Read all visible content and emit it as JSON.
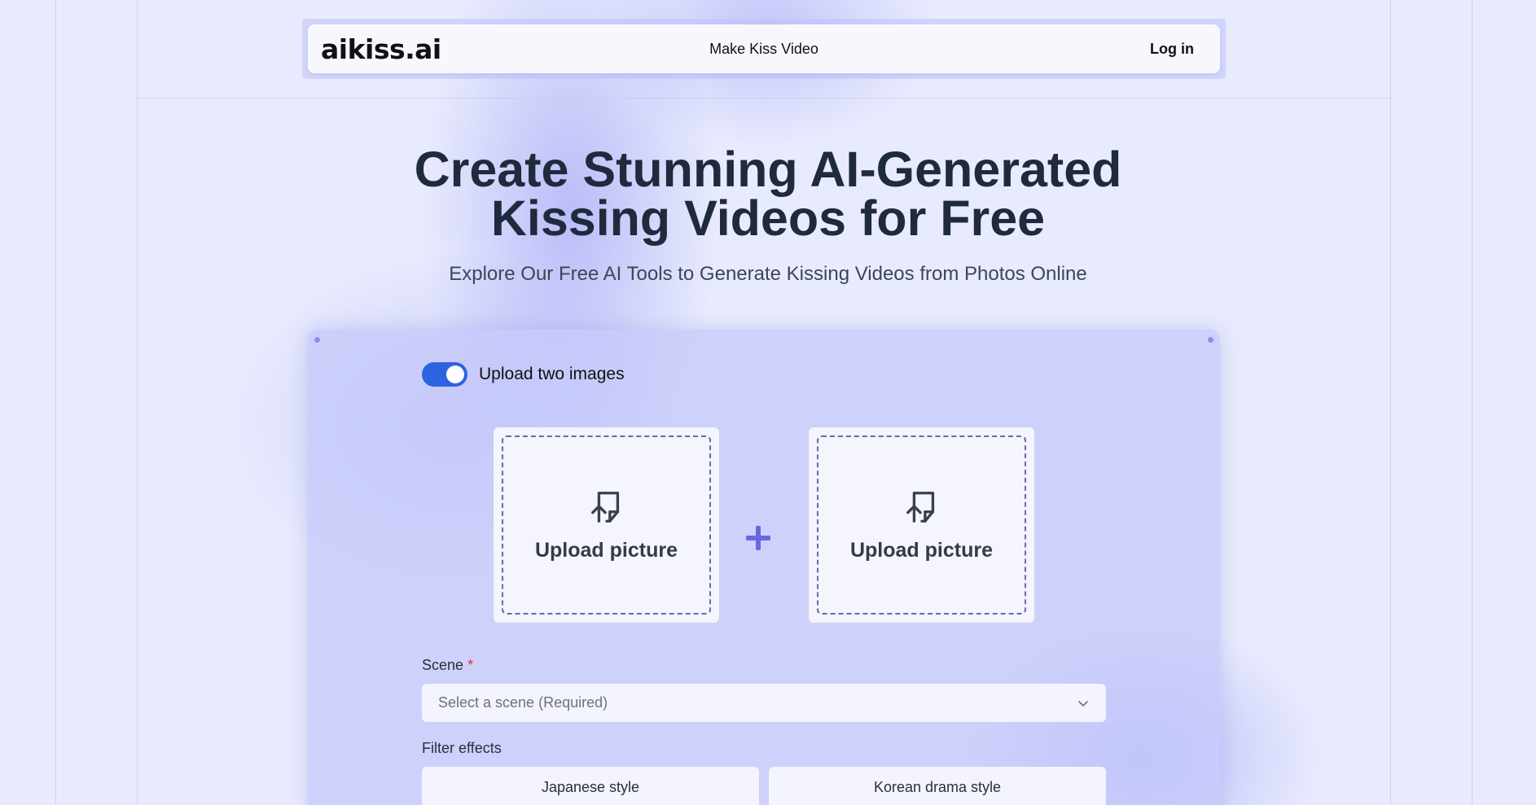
{
  "header": {
    "logo_text": "aikiss.ai",
    "nav_link": "Make Kiss Video",
    "login_label": "Log in"
  },
  "hero": {
    "title_line1": "Create Stunning AI-Generated",
    "title_line2": "Kissing Videos for Free",
    "subtitle": "Explore Our Free AI Tools to Generate Kissing Videos from Photos Online"
  },
  "form": {
    "toggle": {
      "label": "Upload two images",
      "on": true
    },
    "uploads": [
      {
        "label": "Upload picture"
      },
      {
        "label": "Upload picture"
      }
    ],
    "scene": {
      "label": "Scene",
      "required_mark": "*",
      "placeholder": "Select a scene (Required)"
    },
    "filters": {
      "label": "Filter effects",
      "options": [
        "Japanese style",
        "Korean drama style"
      ]
    }
  },
  "colors": {
    "accent": "#2c63e0",
    "plus": "#6b67e0",
    "required": "#e03131",
    "logo_dot": "#e0262e"
  },
  "icons": [
    "upload-file-icon",
    "plus-icon",
    "chevron-down-icon"
  ]
}
